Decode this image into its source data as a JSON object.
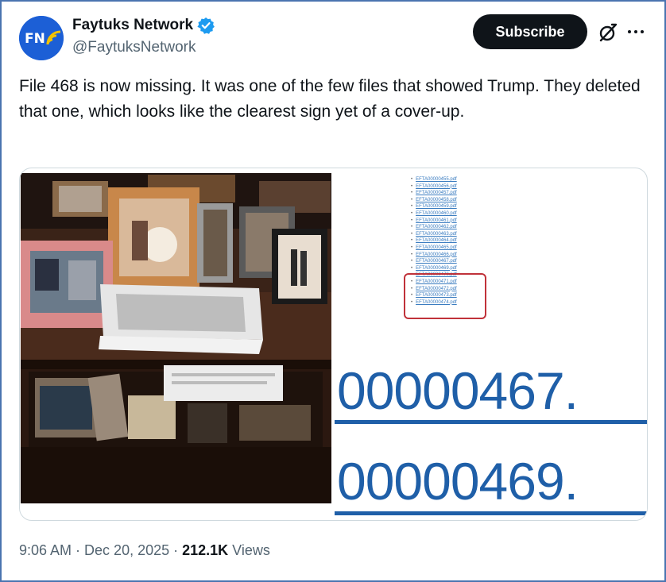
{
  "author": {
    "display_name": "Faytuks Network",
    "handle": "@FaytuksNetwork",
    "avatar_text": "FN",
    "verified": true
  },
  "actions": {
    "subscribe_label": "Subscribe",
    "grok_icon": "grok-icon",
    "more_icon": "more-icon"
  },
  "tweet": {
    "text": "File 468 is now missing. It was one of the few files that showed Trump. They deleted that one, which looks like the clearest sign yet of a cover-up."
  },
  "media": {
    "file_list": [
      "EFTA00000455.pdf",
      "EFTA00000456.pdf",
      "EFTA00000457.pdf",
      "EFTA00000458.pdf",
      "EFTA00000459.pdf",
      "EFTA00000460.pdf",
      "EFTA00000461.pdf",
      "EFTA00000462.pdf",
      "EFTA00000463.pdf",
      "EFTA00000464.pdf",
      "EFTA00000465.pdf",
      "EFTA00000466.pdf",
      "EFTA00000467.pdf",
      "EFTA00000469.pdf",
      "EFTA00000470.pdf",
      "EFTA00000471.pdf",
      "EFTA00000472.pdf",
      "EFTA00000473.pdf",
      "EFTA00000474.pdf"
    ],
    "zoom_line_1": "00000467.",
    "zoom_line_2": "00000469."
  },
  "meta": {
    "time": "9:06 AM",
    "separator": "·",
    "date": "Dec 20, 2025",
    "views_count": "212.1K",
    "views_label": "Views"
  },
  "colors": {
    "subscribe_bg": "#0f1419",
    "verified": "#1d9bf0",
    "link_blue": "#1f5fa8",
    "highlight_red": "#c0323a",
    "frame_border": "#4a74b0"
  }
}
